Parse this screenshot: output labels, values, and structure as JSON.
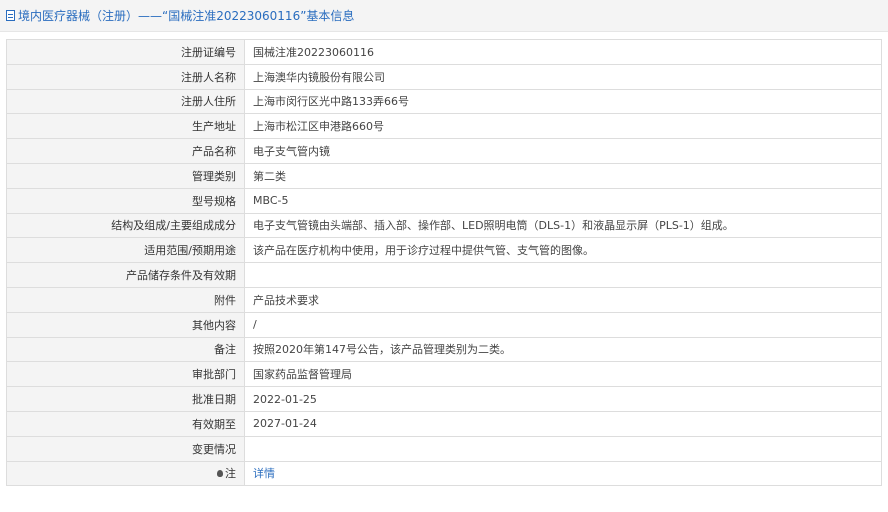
{
  "header": {
    "title": "境内医疗器械（注册）——“国械注准20223060116”基本信息",
    "icon": "document-icon"
  },
  "rows": [
    {
      "label": "注册证编号",
      "value": "国械注准20223060116"
    },
    {
      "label": "注册人名称",
      "value": "上海澳华内镜股份有限公司"
    },
    {
      "label": "注册人住所",
      "value": "上海市闵行区光中路133弄66号"
    },
    {
      "label": "生产地址",
      "value": "上海市松江区申港路660号"
    },
    {
      "label": "产品名称",
      "value": "电子支气管内镜"
    },
    {
      "label": "管理类别",
      "value": "第二类"
    },
    {
      "label": "型号规格",
      "value": "MBC-5"
    },
    {
      "label": "结构及组成/主要组成成分",
      "value": "电子支气管镜由头端部、插入部、操作部、LED照明电筒（DLS-1）和液晶显示屏（PLS-1）组成。"
    },
    {
      "label": "适用范围/预期用途",
      "value": "该产品在医疗机构中使用，用于诊疗过程中提供气管、支气管的图像。"
    },
    {
      "label": "产品储存条件及有效期",
      "value": ""
    },
    {
      "label": "附件",
      "value": "产品技术要求"
    },
    {
      "label": "其他内容",
      "value": "/"
    },
    {
      "label": "备注",
      "value": "按照2020年第147号公告，该产品管理类别为二类。"
    },
    {
      "label": "审批部门",
      "value": "国家药品监督管理局"
    },
    {
      "label": "批准日期",
      "value": "2022-01-25"
    },
    {
      "label": "有效期至",
      "value": "2027-01-24"
    },
    {
      "label": "变更情况",
      "value": ""
    }
  ],
  "note_row": {
    "label": "注",
    "icon": "bulb-icon",
    "link_text": "详情"
  },
  "colors": {
    "link": "#2a6dbf",
    "label_bg": "#f4f4f4",
    "border": "#dddddd"
  }
}
